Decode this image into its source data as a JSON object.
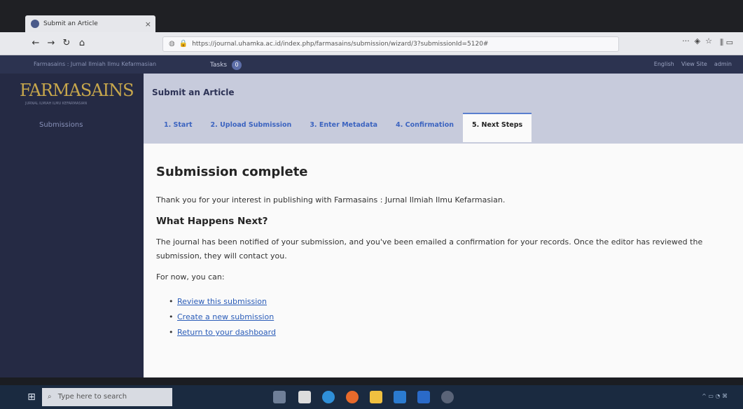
{
  "browser": {
    "tab_title": "Submit an Article",
    "url": "https://journal.uhamka.ac.id/index.php/farmasains/submission/wizard/3?submissionId=5120#",
    "toolbar_dots": "···",
    "reader_icon": "pocket-icon",
    "star_icon": "star-icon"
  },
  "site": {
    "breadcrumb": "Farmasains : Jurnal Ilmiah Ilmu Kefarmasian",
    "tasks_label": "Tasks",
    "tasks_count": "0",
    "lang": "English",
    "view_site": "View Site",
    "user": "admin"
  },
  "sidebar": {
    "logo": "FARMASAINS",
    "logo_sub": "JURNAL ILMIAH ILMU KEFARMASIAN",
    "items": [
      {
        "label": "Submissions"
      }
    ]
  },
  "header": {
    "title": "Submit an Article"
  },
  "wizard_tabs": [
    {
      "label": "1. Start"
    },
    {
      "label": "2. Upload Submission"
    },
    {
      "label": "3. Enter Metadata"
    },
    {
      "label": "4. Confirmation"
    },
    {
      "label": "5. Next Steps"
    }
  ],
  "main": {
    "title": "Submission complete",
    "thanks": "Thank you for your interest in publishing with Farmasains : Jurnal Ilmiah Ilmu Kefarmasian.",
    "next_heading": "What Happens Next?",
    "next_text": "The journal has been notified of your submission, and you've been emailed a confirmation for your records. Once the editor has reviewed the submission, they will contact you.",
    "for_now": "For now, you can:",
    "links": [
      {
        "label": "Review this submission"
      },
      {
        "label": "Create a new submission"
      },
      {
        "label": "Return to your dashboard"
      }
    ]
  },
  "taskbar": {
    "search_placeholder": "Type here to search"
  }
}
